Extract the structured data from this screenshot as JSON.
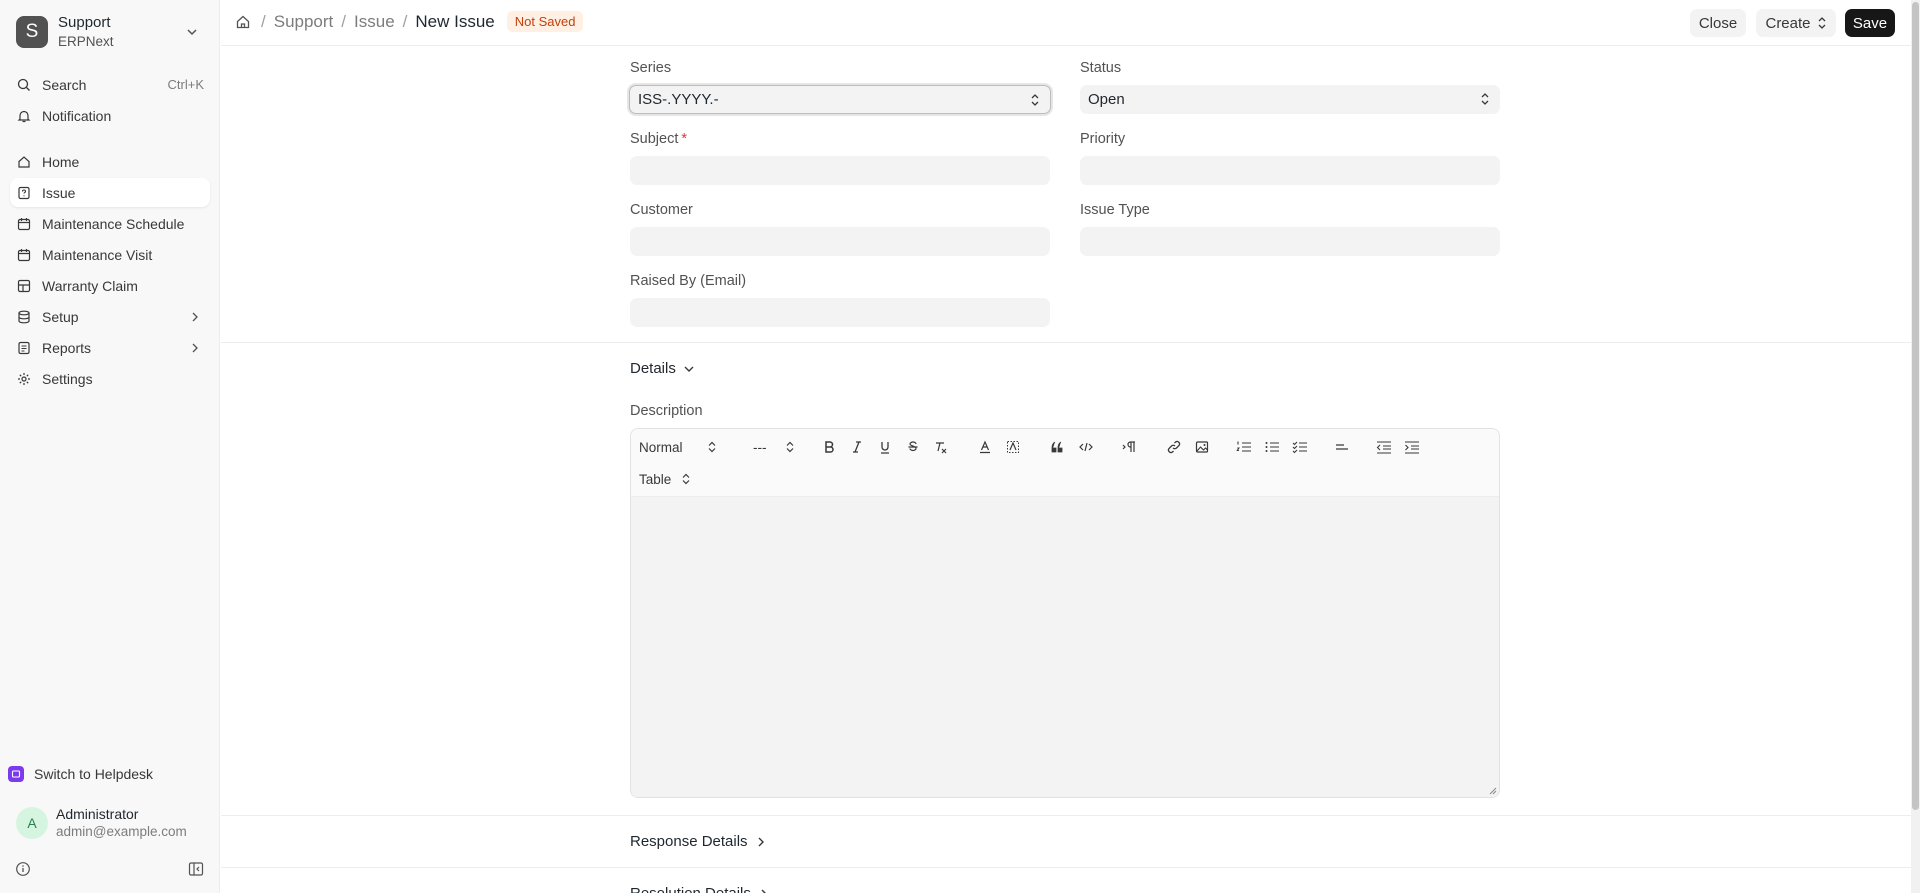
{
  "workspace": {
    "title": "Support",
    "subtitle": "ERPNext",
    "logo_letter": "S"
  },
  "sidebar": {
    "search": {
      "label": "Search",
      "shortcut": "Ctrl+K"
    },
    "notification": "Notification",
    "items": [
      {
        "label": "Home",
        "icon": "home-icon"
      },
      {
        "label": "Issue",
        "icon": "help-file-icon",
        "active": true
      },
      {
        "label": "Maintenance Schedule",
        "icon": "calendar-icon"
      },
      {
        "label": "Maintenance Visit",
        "icon": "calendar-icon"
      },
      {
        "label": "Warranty Claim",
        "icon": "table-grid-icon"
      },
      {
        "label": "Setup",
        "icon": "database-icon",
        "expandable": true
      },
      {
        "label": "Reports",
        "icon": "report-icon",
        "expandable": true
      },
      {
        "label": "Settings",
        "icon": "gear-icon"
      }
    ],
    "helpdesk": "Switch to Helpdesk",
    "user": {
      "initial": "A",
      "name": "Administrator",
      "email": "admin@example.com"
    }
  },
  "header": {
    "breadcrumbs": [
      "Support",
      "Issue"
    ],
    "current": "New Issue",
    "status_badge": "Not Saved",
    "buttons": {
      "close": "Close",
      "create": "Create",
      "save": "Save"
    }
  },
  "form": {
    "series": {
      "label": "Series",
      "value": "ISS-.YYYY.-"
    },
    "status": {
      "label": "Status",
      "value": "Open"
    },
    "subject": {
      "label": "Subject",
      "required": "*",
      "value": ""
    },
    "priority": {
      "label": "Priority",
      "value": ""
    },
    "customer": {
      "label": "Customer",
      "value": ""
    },
    "issue_type": {
      "label": "Issue Type",
      "value": ""
    },
    "raised_by": {
      "label": "Raised By (Email)",
      "value": ""
    }
  },
  "details": {
    "section_label": "Details",
    "description_label": "Description",
    "toolbar": {
      "text_style": "Normal",
      "font_size": "---",
      "table": "Table"
    }
  },
  "sections": {
    "response": "Response Details",
    "resolution": "Resolution Details"
  },
  "colors": {
    "primary_button": "#171717",
    "badge_bg": "#fff0e3",
    "badge_text": "#c2410c",
    "helpdesk_icon": "#7c3aed"
  }
}
